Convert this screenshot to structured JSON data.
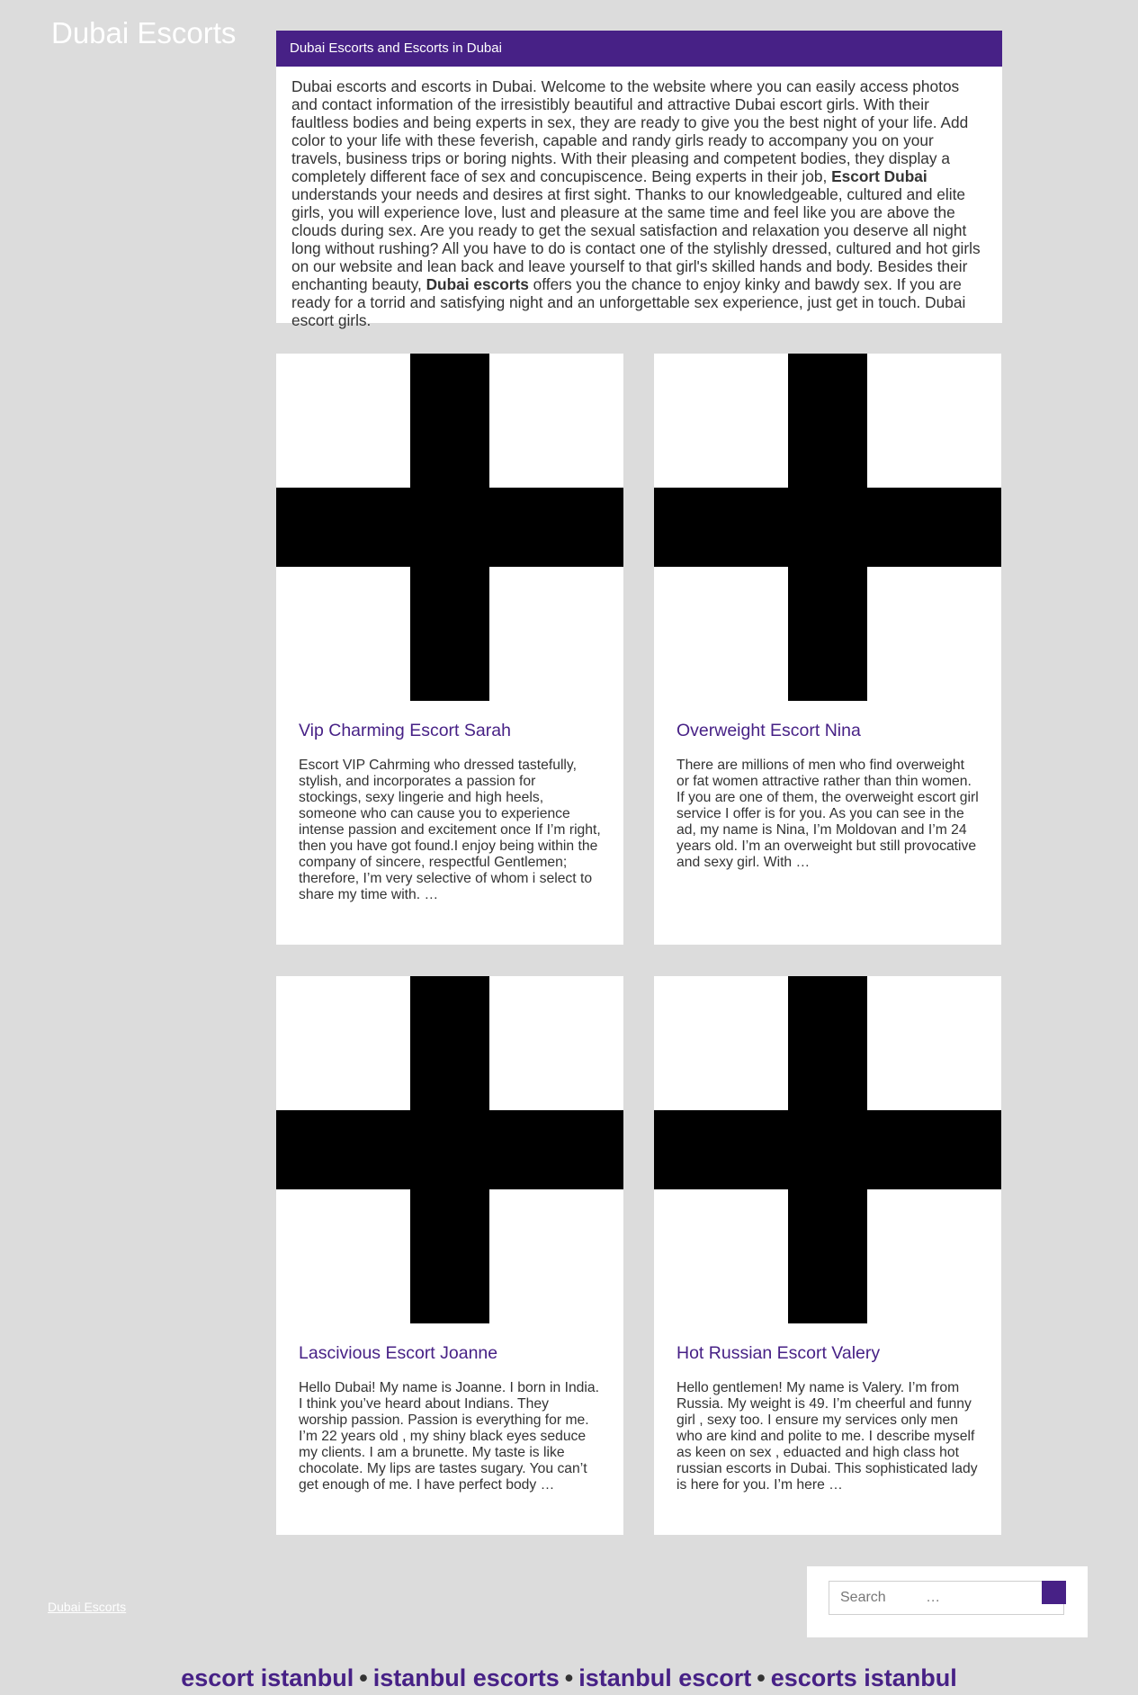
{
  "site": {
    "title": "Dubai Escorts"
  },
  "intro": {
    "heading": "Dubai Escorts and Escorts in Dubai",
    "p1": "Dubai escorts and escorts in Dubai. Welcome to the website where you can easily access photos and contact information of the irresistibly beautiful and attractive Dubai escort girls. With their faultless bodies and being experts in sex, they are ready to give you the best night of your life. Add color to your life with these feverish, capable and randy girls ready to accompany you on your travels, business trips or boring nights. With their pleasing and competent bodies, they display a completely different face of sex and concupiscence. Being experts in their job, ",
    "bold1": "Escort Dubai",
    "p2": " understands your needs and desires at first sight. Thanks to our knowledgeable, cultured and elite girls, you will experience love, lust and pleasure at the same time and feel like you are above the clouds during sex. Are you ready to get the sexual satisfaction and relaxation you deserve all night long without rushing? All you have to do is contact one of the stylishly dressed, cultured and hot girls on our website and lean back and leave yourself to that girl's skilled hands and body. Besides their enchanting beauty, ",
    "bold2": "Dubai escorts",
    "p3": " offers you the chance to enjoy kinky and bawdy sex. If you are ready for a torrid and satisfying night and an unforgettable sex experience, just get in touch. Dubai escort girls."
  },
  "posts": [
    {
      "title": "Vip Charming Escort Sarah",
      "excerpt": "Escort VIP Cahrming who dressed tastefully, stylish, and incorporates a passion for stockings, sexy lingerie and high heels, someone who can cause you to experience intense passion and excitement once If I’m right, then you have got found.I enjoy being within the company of sincere, respectful Gentlemen; therefore, I’m very selective of whom i select to share my time with. …"
    },
    {
      "title": "Overweight Escort Nina",
      "excerpt": "There are millions of men who find overweight or fat women attractive rather than thin women. If you are one of them, the overweight escort girl service I offer is for you. As you can see in the ad, my name is Nina, I’m Moldovan and I’m 24 years old. I’m an overweight but still provocative and sexy girl. With …"
    },
    {
      "title": "Lascivious Escort Joanne",
      "excerpt": "Hello Dubai! My name is Joanne. I born in India. I think you’ve heard about Indians. They worship passion. Passion is everything for me. I’m 22 years old , my shiny black eyes seduce my clients. I am a brunette. My taste is like chocolate. My lips are tastes sugary. You can’t get enough of me. I have perfect body …"
    },
    {
      "title": "Hot Russian Escort Valery",
      "excerpt": "Hello gentlemen! My name is Valery. I’m from Russia. My weight is 49. I’m cheerful and funny girl , sexy too. I ensure my services only men who are kind and polite to me. I describe myself as keen on sex , eduacted and high class hot russian escorts in Dubai. This sophisticated lady is here for you. I’m here …"
    }
  ],
  "footer": {
    "link": "Dubai Escorts",
    "search_placeholder": "Search          …",
    "links": [
      "escort istanbul",
      "istanbul escorts",
      "istanbul escort",
      "escorts istanbul"
    ],
    "separator": "•"
  },
  "colors": {
    "accent": "#472186",
    "background": "#dcdcdc"
  }
}
